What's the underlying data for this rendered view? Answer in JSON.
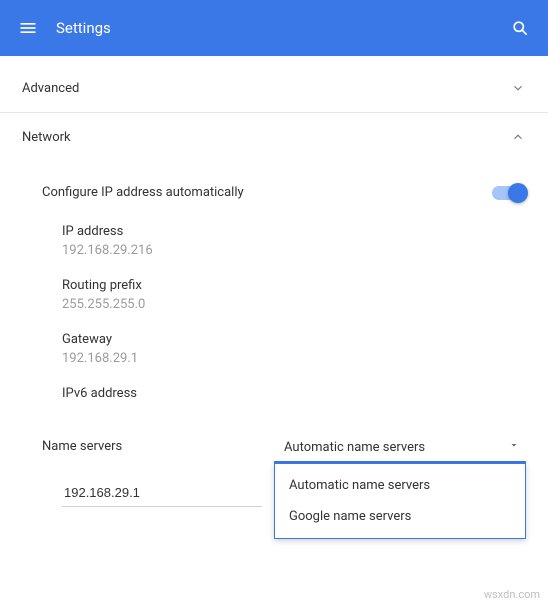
{
  "appbar": {
    "title": "Settings"
  },
  "sections": {
    "advanced": {
      "label": "Advanced",
      "expanded": false
    },
    "network": {
      "label": "Network",
      "expanded": true
    }
  },
  "network": {
    "configure_auto_label": "Configure IP address automatically",
    "configure_auto_on": true,
    "ip_label": "IP address",
    "ip_value": "192.168.29.216",
    "routing_label": "Routing prefix",
    "routing_value": "255.255.255.0",
    "gateway_label": "Gateway",
    "gateway_value": "192.168.29.1",
    "ipv6_label": "IPv6 address",
    "ipv6_value": "",
    "nameservers_label": "Name servers",
    "nameservers_select": {
      "selected": "Automatic name servers",
      "options": [
        "Automatic name servers",
        "Google name servers"
      ]
    },
    "nameserver_input_value": "192.168.29.1"
  },
  "watermark": "wsxdn.com"
}
